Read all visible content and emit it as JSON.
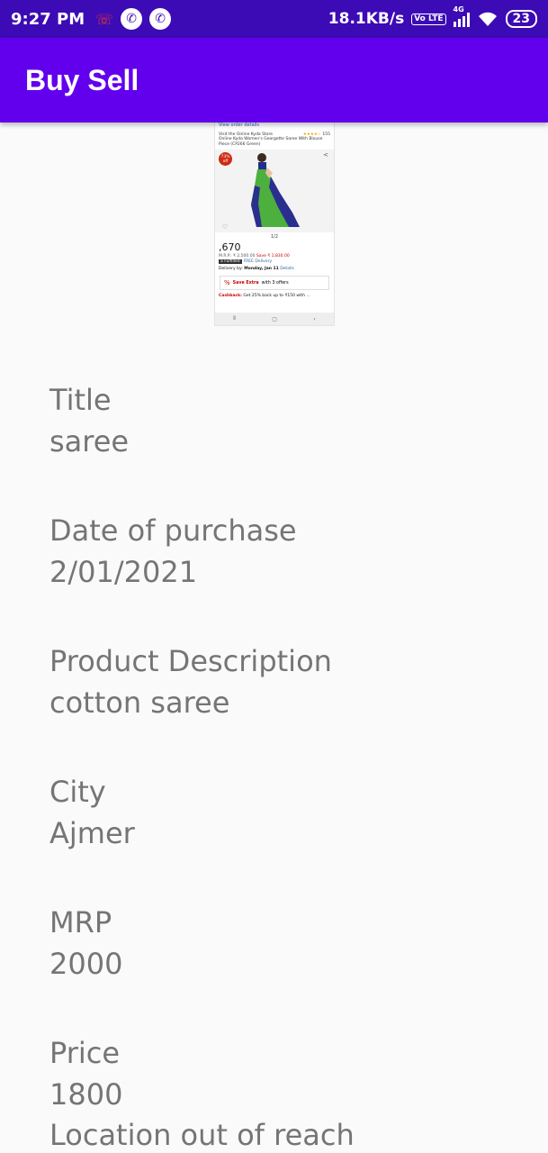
{
  "status_bar": {
    "time": "9:27 PM",
    "net_speed": "18.1KB/s",
    "volte": "Vo LTE",
    "network": "4G",
    "battery": "23"
  },
  "app_bar": {
    "title": "Buy Sell"
  },
  "product_image": {
    "header": "View order details",
    "brand": "Visit the Online Kyda Store",
    "rating_count": "155",
    "product_name": "Online Kyda Women's Georgette Saree With Blouse Piece (CP266 Green)",
    "discount_badge": "73% off",
    "pager": "1/2",
    "price": ",670",
    "mrp_line": "M.R.P.: ₹ 2,500.00",
    "save_line": "Save ₹ 1,830.00",
    "fulfilled": "a Fulfilled",
    "free_delivery": "FREE Delivery",
    "delivery_prefix": "Delivery by:",
    "delivery_date": "Monday, Jan 11",
    "delivery_details": "Details",
    "offer_save": "Save Extra",
    "offer_rest": "with 3 offers",
    "cashback_label": "Cashback:",
    "cashback_text": "Get 25% back up to ₹150 with ..."
  },
  "details": [
    {
      "label": "Title",
      "value": "saree"
    },
    {
      "label": "Date of purchase",
      "value": "2/01/2021"
    },
    {
      "label": "Product Description",
      "value": "cotton saree"
    },
    {
      "label": "City",
      "value": "Ajmer"
    },
    {
      "label": "MRP",
      "value": "2000"
    },
    {
      "label": "Price",
      "value": "1800"
    }
  ],
  "location_status": "Location out of reach",
  "colors": {
    "status_bar": "#3c0bb5",
    "app_bar": "#6200ee",
    "text": "#757575",
    "background": "#fafafa"
  }
}
